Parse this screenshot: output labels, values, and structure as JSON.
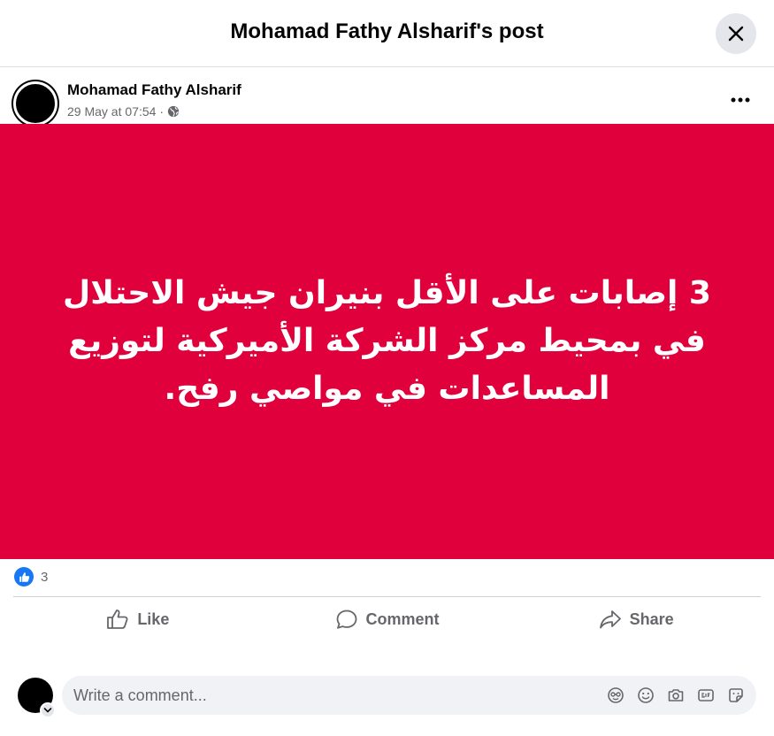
{
  "header": {
    "title": "Mohamad Fathy Alsharif's post"
  },
  "post": {
    "author": "Mohamad Fathy Alsharif",
    "timestamp": "29 May at 07:54",
    "separator": "·",
    "privacy_icon": "globe-icon",
    "image_text": "3 إصابات على الأقل بنيران جيش الاحتلال في بمحيط مركز الشركة الأميركية لتوزيع المساعدات في مواصي رفح.",
    "image_background": "#e0003c",
    "reaction_count": "3"
  },
  "actions": {
    "like_label": "Like",
    "comment_label": "Comment",
    "share_label": "Share"
  },
  "comment": {
    "placeholder": "Write a comment...",
    "icons": [
      "avatar-sticker-icon",
      "emoji-icon",
      "camera-icon",
      "gif-icon",
      "sticker-icon"
    ]
  },
  "colors": {
    "accent": "#1877f2",
    "secondary_text": "#65676b",
    "close_bg": "#e4e6eb"
  }
}
